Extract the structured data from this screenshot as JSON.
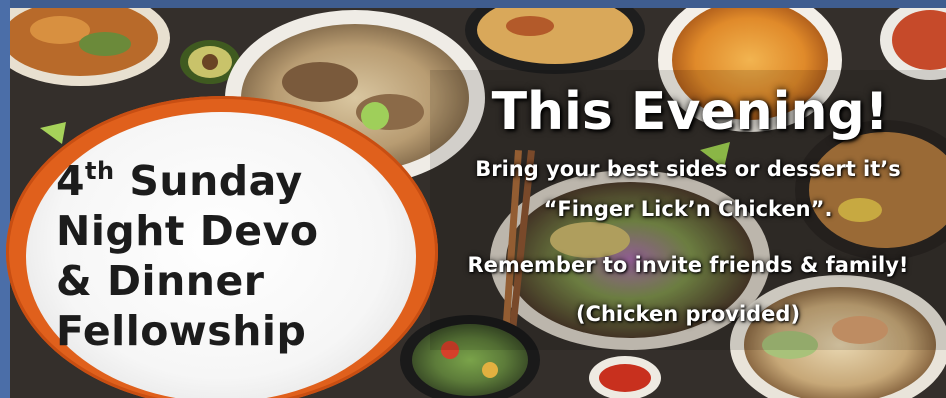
{
  "banner": {
    "circle": {
      "line1_prefix": "4",
      "line1_sup": "th",
      "line1_suffix": " Sunday",
      "line2": "Night Devo",
      "line3": "& Dinner",
      "line4": "Fellowship"
    },
    "headline": "This Evening!",
    "message_line1": "Bring your best sides or dessert it’s",
    "message_line2": "“Finger Lick’n Chicken”.",
    "message_line3": "Remember to invite friends & family!",
    "message_line4": "(Chicken provided)"
  },
  "colors": {
    "circle_ring": "#e0601c",
    "frame": "#4b6ea8",
    "text_dark": "#1c1c1c",
    "text_light": "#ffffff"
  }
}
